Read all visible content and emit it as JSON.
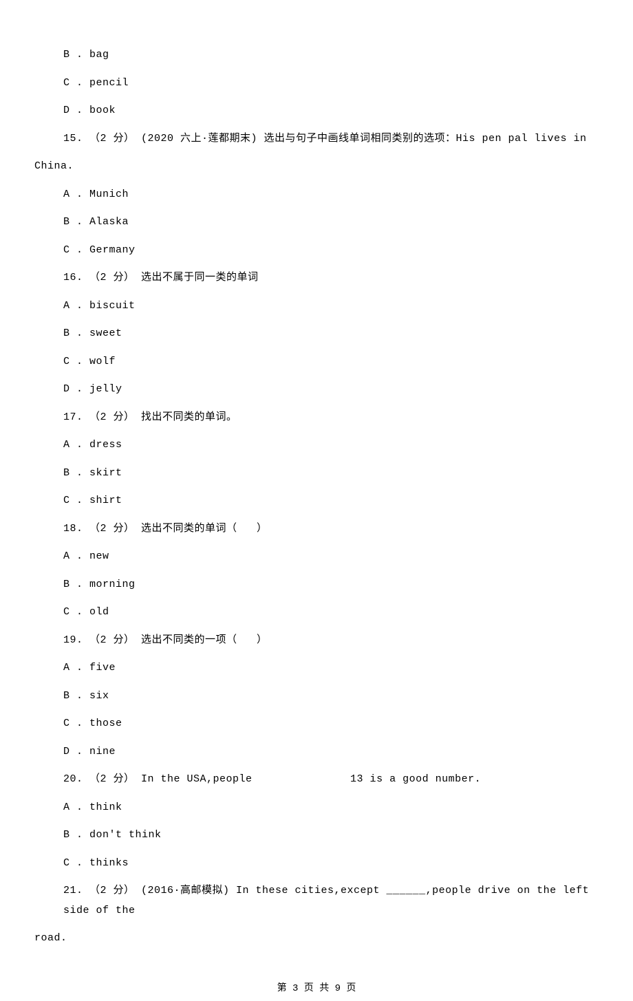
{
  "lines": {
    "opt_b_bag": "B . bag",
    "opt_c_pencil": "C . pencil",
    "opt_d_book": "D . book",
    "q15": "15. （2 分） (2020 六上·莲都期末) 选出与句子中画线单词相同类别的选项：His pen pal lives in",
    "q15_tail": "China.",
    "q15_a": "A . Munich",
    "q15_b": "B . Alaska",
    "q15_c": "C . Germany",
    "q16": "16. （2 分） 选出不属于同一类的单词",
    "q16_a": "A . biscuit",
    "q16_b": "B . sweet",
    "q16_c": "C . wolf",
    "q16_d": "D . jelly",
    "q17": "17. （2 分） 找出不同类的单词。",
    "q17_a": "A . dress",
    "q17_b": "B . skirt",
    "q17_c": "C . shirt",
    "q18": "18. （2 分） 选出不同类的单词（   ）",
    "q18_a": "A . new",
    "q18_b": "B . morning",
    "q18_c": "C . old",
    "q19": "19. （2 分） 选出不同类的一项（   ）",
    "q19_a": "A . five",
    "q19_b": "B . six",
    "q19_c": "C . those",
    "q19_d": "D . nine",
    "q20": "20. （2 分） In the USA,people               13 is a good number.",
    "q20_a": "A . think",
    "q20_b": "B . don't think",
    "q20_c": "C . thinks",
    "q21": "21. （2 分） (2016·高邮模拟) In these cities,except ______,people drive on the left side of the",
    "q21_tail": "road."
  },
  "footer": "第 3 页 共 9 页"
}
